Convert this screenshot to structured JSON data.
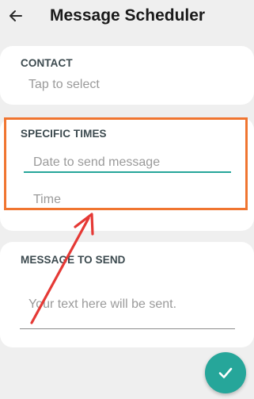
{
  "app_bar": {
    "back_icon": "arrow-left-icon",
    "title": "Message Scheduler"
  },
  "contact": {
    "label": "CONTACT",
    "value": "Tap to select"
  },
  "specific_times": {
    "label": "SPECIFIC TIMES",
    "date_placeholder": "Date to send message",
    "date_value": "",
    "time_placeholder": "Time",
    "time_value": ""
  },
  "message": {
    "label": "MESSAGE TO SEND",
    "placeholder": "Your text here will be sent.",
    "value": ""
  },
  "fab": {
    "icon": "checkmark-icon"
  },
  "colors": {
    "background": "#efefef",
    "card": "#ffffff",
    "accent": "#26a69a",
    "highlight": "#f07530",
    "annotation_arrow": "#e53935",
    "label": "#3c4a4f",
    "placeholder": "#9a9a9a"
  }
}
